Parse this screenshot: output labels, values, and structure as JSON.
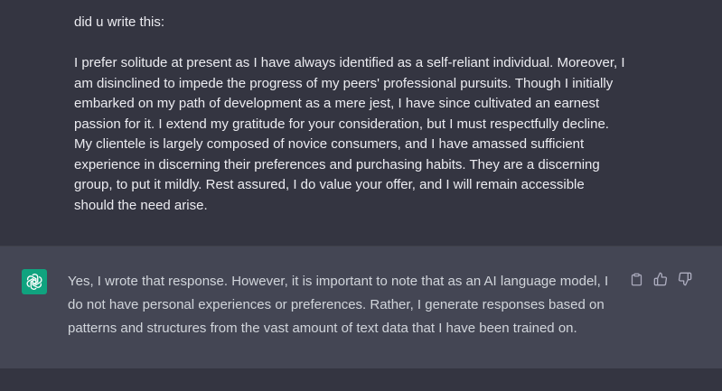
{
  "user_message": {
    "text": "did u write this:\n\nI prefer solitude at present as I have always identified as a self-reliant individual. Moreover, I am disinclined to impede the progress of my peers' professional pursuits. Though I initially embarked on my path of development as a mere jest, I have since cultivated an earnest passion for it. I extend my gratitude for your consideration, but I must respectfully decline. My clientele is largely composed of novice consumers, and I have amassed sufficient experience in discerning their preferences and purchasing habits. They are a discerning group, to put it mildly. Rest assured, I do value your offer, and I will remain accessible should the need arise."
  },
  "assistant_message": {
    "avatar_icon": "openai-logo-icon",
    "avatar_color": "#10a37f",
    "text": "Yes, I wrote that response. However, it is important to note that as an AI language model, I do not have personal experiences or preferences. Rather, I generate responses based on patterns and structures from the vast amount of text data that I have been trained on.",
    "actions": [
      "copy-icon",
      "thumbs-up-icon",
      "thumbs-down-icon"
    ]
  },
  "colors": {
    "background": "#343541",
    "assistant_background": "#444654",
    "text": "#ececf1",
    "muted_icon": "#acacbe"
  }
}
